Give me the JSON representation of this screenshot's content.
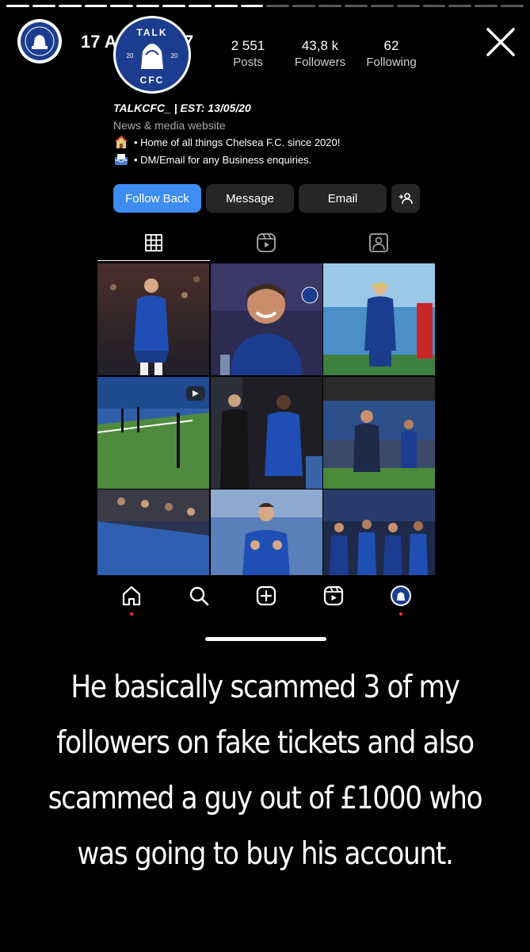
{
  "story": {
    "timestamp": "17 April 18:27",
    "progress_total": 20,
    "progress_done": 10
  },
  "profile": {
    "logo_text_top": "TALK",
    "logo_text_bottom": "CFC",
    "logo_year_left": "20",
    "logo_year_right": "20",
    "stats": {
      "posts_value": "2 551",
      "posts_label": "Posts",
      "followers_value": "43,8 k",
      "followers_label": "Followers",
      "following_value": "62",
      "following_label": "Following"
    },
    "bio": {
      "name": "TALKCFC_ | EST: 13/05/20",
      "category": "News & media website",
      "line1": "• Home of all things Chelsea F.C. since 2020!",
      "line2": "• DM/Email for any Business enquiries."
    },
    "buttons": {
      "follow_back": "Follow Back",
      "message": "Message",
      "email": "Email"
    }
  },
  "caption": "He basically scammed 3 of my followers on fake tickets and also scammed a guy out of £1000 who was going to buy his account.",
  "colors": {
    "primary_button": "#3d8df2",
    "chelsea_blue": "#1c3d8f",
    "notification_dot": "#ff3040"
  },
  "icons": {
    "close": "close-icon",
    "grid": "grid-icon",
    "reels": "reels-icon",
    "tagged": "tagged-icon",
    "home": "home-icon",
    "search": "search-icon",
    "create": "create-icon",
    "add_person": "add-person-icon"
  }
}
